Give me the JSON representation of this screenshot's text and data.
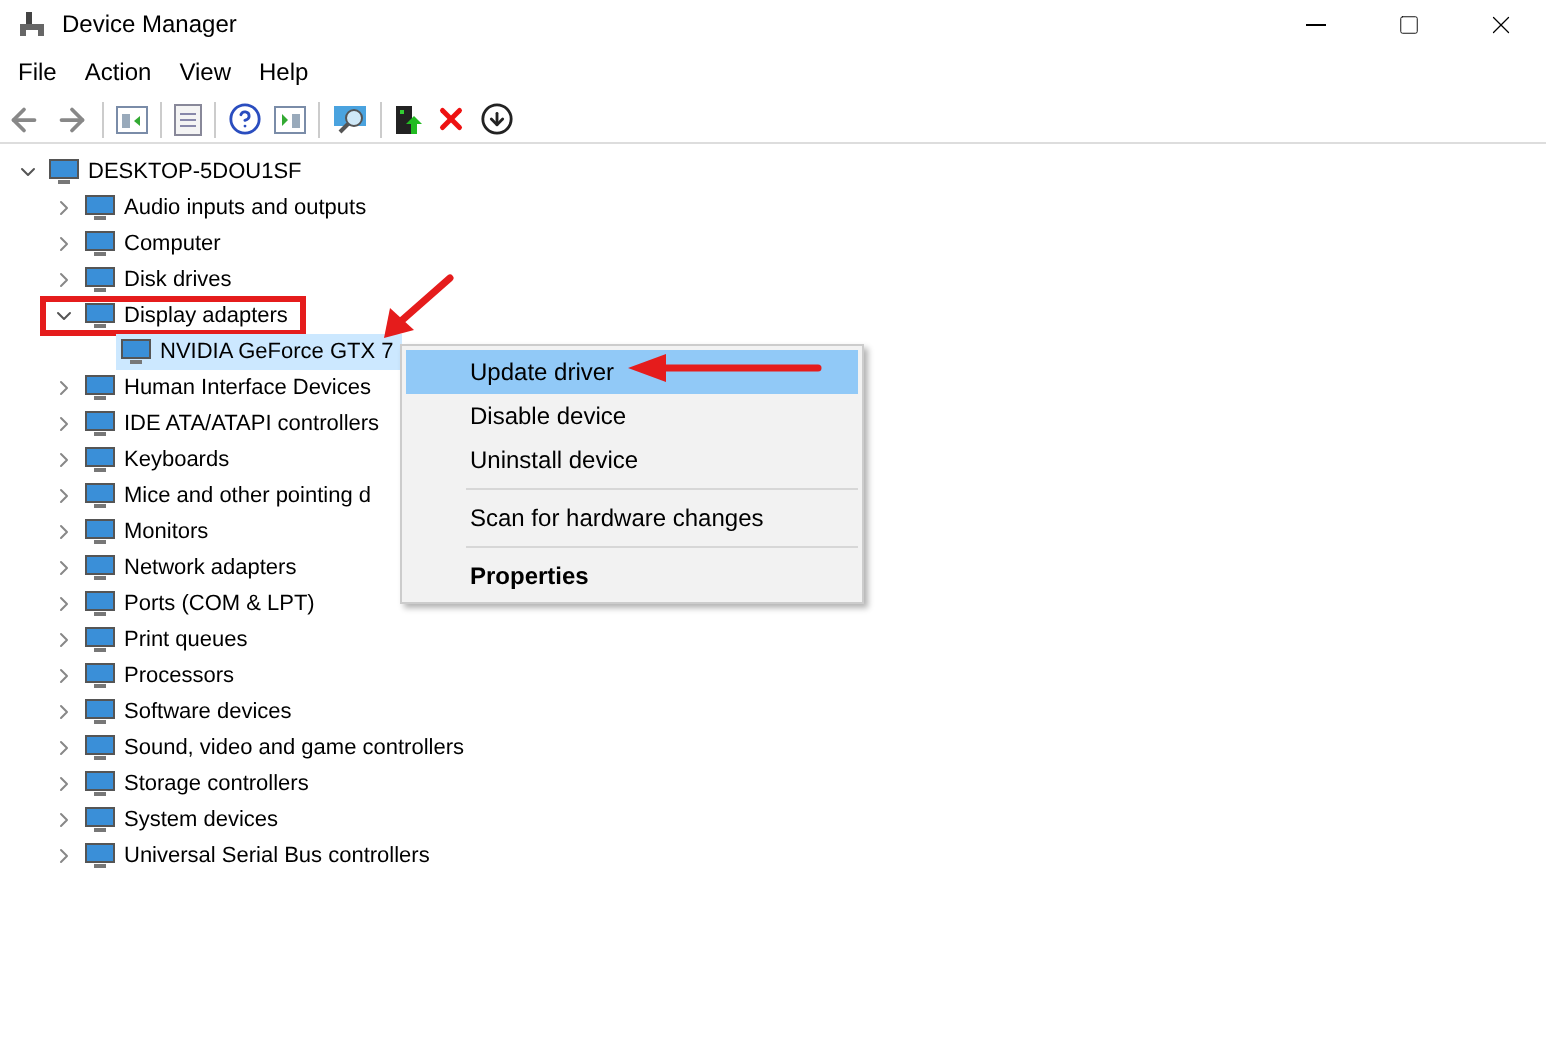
{
  "window": {
    "title": "Device Manager"
  },
  "menu": [
    "File",
    "Action",
    "View",
    "Help"
  ],
  "tree": {
    "label": "DESKTOP-5DOU1SF",
    "expanded": true,
    "selected": false,
    "children": [
      {
        "label": "Audio inputs and outputs",
        "expanded": false,
        "selected": false
      },
      {
        "label": "Computer",
        "expanded": false,
        "selected": false
      },
      {
        "label": "Disk drives",
        "expanded": false,
        "selected": false
      },
      {
        "label": "Display adapters",
        "expanded": true,
        "selected": false,
        "highlighted": true,
        "children": [
          {
            "label": "NVIDIA GeForce GTX 7",
            "selected": true
          }
        ]
      },
      {
        "label": "Human Interface Devices",
        "expanded": false,
        "selected": false
      },
      {
        "label": "IDE ATA/ATAPI controllers",
        "expanded": false,
        "selected": false
      },
      {
        "label": "Keyboards",
        "expanded": false,
        "selected": false
      },
      {
        "label": "Mice and other pointing d",
        "expanded": false,
        "selected": false
      },
      {
        "label": "Monitors",
        "expanded": false,
        "selected": false
      },
      {
        "label": "Network adapters",
        "expanded": false,
        "selected": false
      },
      {
        "label": "Ports (COM & LPT)",
        "expanded": false,
        "selected": false
      },
      {
        "label": "Print queues",
        "expanded": false,
        "selected": false
      },
      {
        "label": "Processors",
        "expanded": false,
        "selected": false
      },
      {
        "label": "Software devices",
        "expanded": false,
        "selected": false
      },
      {
        "label": "Sound, video and game controllers",
        "expanded": false,
        "selected": false
      },
      {
        "label": "Storage controllers",
        "expanded": false,
        "selected": false
      },
      {
        "label": "System devices",
        "expanded": false,
        "selected": false
      },
      {
        "label": "Universal Serial Bus controllers",
        "expanded": false,
        "selected": false
      }
    ]
  },
  "context_menu": [
    {
      "kind": "item",
      "label": "Update driver",
      "selected": true
    },
    {
      "kind": "item",
      "label": "Disable device",
      "selected": false
    },
    {
      "kind": "item",
      "label": "Uninstall device",
      "selected": false
    },
    {
      "kind": "separator"
    },
    {
      "kind": "item",
      "label": "Scan for hardware changes",
      "selected": false
    },
    {
      "kind": "separator"
    },
    {
      "kind": "default",
      "label": "Properties",
      "selected": false
    }
  ]
}
